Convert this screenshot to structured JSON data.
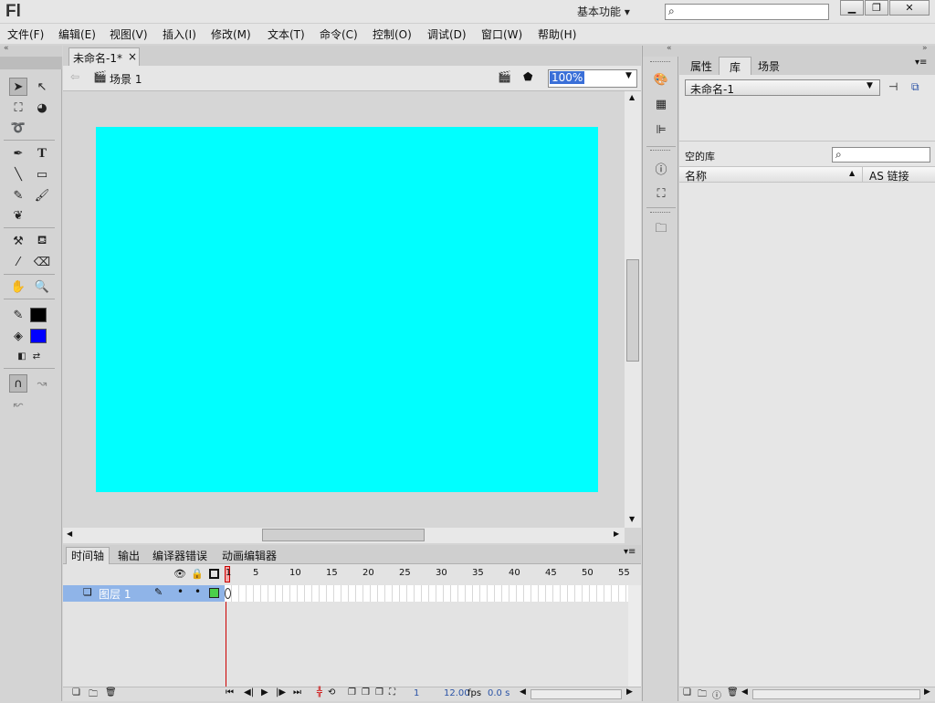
{
  "app": {
    "logo": "Fl",
    "workspace": "基本功能 ▾",
    "search": {
      "value": "",
      "placeholder": ""
    }
  },
  "window_buttons": {
    "minimize": "▁",
    "restore": "❐",
    "close": "✕"
  },
  "menu": [
    "文件(F)",
    "编辑(E)",
    "视图(V)",
    "插入(I)",
    "修改(M)",
    "文本(T)",
    "命令(C)",
    "控制(O)",
    "调试(D)",
    "窗口(W)",
    "帮助(H)"
  ],
  "document": {
    "tab_label": "未命名-1*",
    "tab_close": "×",
    "scene": "场景 1",
    "zoom": "100%",
    "stage_color": "#00ffff"
  },
  "timeline": {
    "tabs": [
      "时间轴",
      "输出",
      "编译器错误",
      "动画编辑器"
    ],
    "frame_numbers": [
      "1",
      "5",
      "10",
      "15",
      "20",
      "25",
      "30",
      "35",
      "40",
      "45",
      "50",
      "55"
    ],
    "layer_name": "图层 1",
    "status": {
      "frame": "1",
      "fps": "12.00",
      "fps_unit": "fps",
      "time": "0.0 s"
    }
  },
  "right_panel": {
    "tabs": [
      "属性",
      "库",
      "场景"
    ],
    "document_select": "未命名-1",
    "empty_label": "空的库",
    "columns": {
      "name": "名称",
      "linkage": "AS 链接"
    }
  },
  "colors": {
    "stroke": "#000000",
    "fill": "#0000ff",
    "layer_highlight": "#8fb4e8",
    "playhead": "#cc0000"
  }
}
